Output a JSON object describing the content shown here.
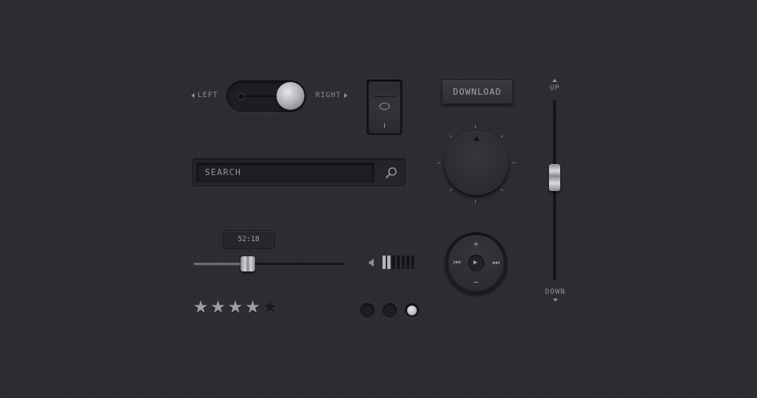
{
  "toggle": {
    "left_label": "LEFT",
    "right_label": "RIGHT",
    "state": "right"
  },
  "rocker": {
    "on_symbol": "I",
    "off_symbol": "O",
    "state": "off"
  },
  "download": {
    "label": "DOWNLOAD"
  },
  "search": {
    "placeholder": "SEARCH",
    "icon": "search-icon"
  },
  "knob": {
    "icon": "dial-icon"
  },
  "slider": {
    "time": "52:18",
    "position_fraction": 0.36
  },
  "volume": {
    "level_bars": 2,
    "total_bars": 7,
    "icon": "speaker-icon"
  },
  "media": {
    "up": "+",
    "down": "−",
    "prev": "⏮",
    "play": "▶",
    "next": "⏭"
  },
  "vslider": {
    "up_label": "UP",
    "down_label": "DOWN",
    "position_fraction": 0.43
  },
  "rating": {
    "value": 4,
    "max": 5
  },
  "pager": {
    "count": 3,
    "active": 3
  },
  "colors": {
    "background": "#2b2c30",
    "accent_metal": "#c9cacd"
  }
}
